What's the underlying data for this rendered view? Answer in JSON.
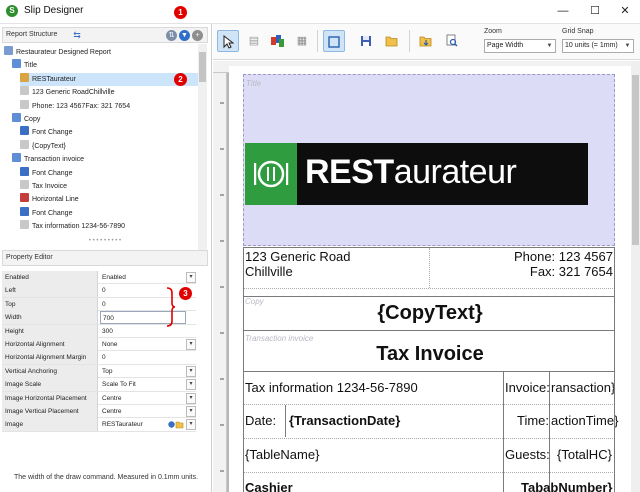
{
  "window": {
    "title": "Slip Designer",
    "minimize_glyph": "—",
    "maximize_glyph": "☐",
    "close_glyph": "✕"
  },
  "callouts": {
    "one": "1",
    "two": "2",
    "three": "3"
  },
  "report_structure": {
    "title": "Report Structure",
    "tree": [
      {
        "label": "Restaurateur Designed Report",
        "icon": "report-icon"
      },
      {
        "label": "Title",
        "icon": "band-icon"
      },
      {
        "label": "RESTaurateur",
        "icon": "image-icon",
        "selected": true
      },
      {
        "label": "123 Generic RoadChillville",
        "icon": "text-icon"
      },
      {
        "label": "Phone: 123 4567Fax: 321 7654",
        "icon": "text-icon"
      },
      {
        "label": "Copy",
        "icon": "band-icon"
      },
      {
        "label": "Font Change",
        "icon": "font-icon"
      },
      {
        "label": "{CopyText}",
        "icon": "text-icon"
      },
      {
        "label": "Transaction invoice",
        "icon": "band-icon"
      },
      {
        "label": "Font Change",
        "icon": "font-icon"
      },
      {
        "label": "Tax Invoice",
        "icon": "text-icon"
      },
      {
        "label": "Horizontal Line",
        "icon": "line-icon"
      },
      {
        "label": "Font Change",
        "icon": "font-icon"
      },
      {
        "label": "Tax information 1234-56-7890",
        "icon": "text-icon"
      }
    ]
  },
  "property_editor": {
    "title": "Property Editor",
    "rows": [
      {
        "name": "Enabled",
        "value": "Enabled",
        "dropdown": true
      },
      {
        "name": "Left",
        "value": "0"
      },
      {
        "name": "Top",
        "value": "0"
      },
      {
        "name": "Width",
        "value": "700",
        "editing": true
      },
      {
        "name": "Height",
        "value": "300"
      },
      {
        "name": "Horizontal Alignment",
        "value": "None",
        "dropdown": true
      },
      {
        "name": "Horizontal Alignment Margin",
        "value": "0"
      },
      {
        "name": "Vertical Anchoring",
        "value": "Top",
        "dropdown": true
      },
      {
        "name": "Image Scale",
        "value": "Scale To Fit",
        "dropdown": true
      },
      {
        "name": "Image Horizontal Placement",
        "value": "Centre",
        "dropdown": true
      },
      {
        "name": "Image Vertical Placement",
        "value": "Centre",
        "dropdown": true
      },
      {
        "name": "Image",
        "value": "RESTaurateur",
        "dropdown": true
      }
    ],
    "description": "The width of the draw command. Measured in 0.1mm units."
  },
  "toolbar": {
    "zoom_label": "Zoom",
    "zoom_value": "Page Width",
    "grid_label": "Grid Snap",
    "grid_value": "10 units (= 1mm)"
  },
  "canvas": {
    "band_title": "Title",
    "band_copy": "Copy",
    "band_transaction": "Transaction invoice",
    "logo_bold": "REST",
    "logo_light": "aurateur",
    "address_line1": "123 Generic Road",
    "address_line2": "Chillville",
    "phone": "Phone: 123 4567",
    "fax": "Fax: 321 7654",
    "copy_text": "{CopyText}",
    "tax_invoice": "Tax Invoice",
    "tax_info": "Tax information 1234-56-7890",
    "invoice_label": "Invoice:",
    "invoice_value": "ransaction}",
    "date_label": "Date:",
    "date_value": "{TransactionDate}",
    "time_label": "Time:",
    "time_value": "actionTime}",
    "table_name": "{TableName}",
    "guests_label": "Guests:",
    "guests_value": "{TotalHC}",
    "cashier_label": "Cashier",
    "tab_number": "TababNumber}"
  }
}
